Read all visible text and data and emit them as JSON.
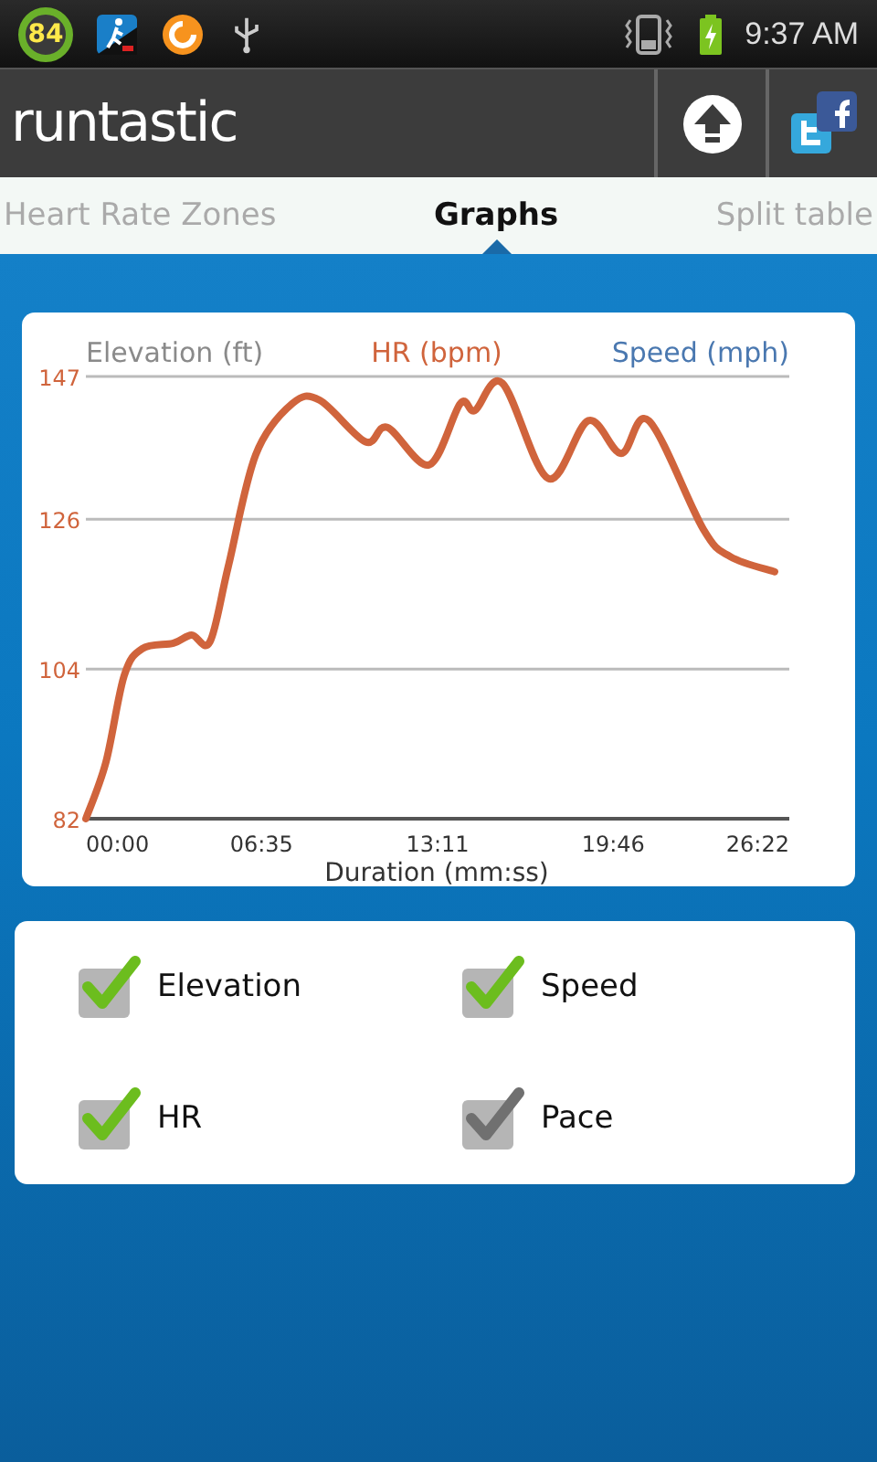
{
  "status_bar": {
    "battery_badge": "84",
    "time": "9:37 AM"
  },
  "header": {
    "logo": "runtastic"
  },
  "tabs": [
    {
      "label": "Heart Rate Zones",
      "selected": false
    },
    {
      "label": "Graphs",
      "selected": true
    },
    {
      "label": "Split table",
      "selected": false
    }
  ],
  "graph_card": {
    "legend": [
      {
        "label": "Elevation (ft)",
        "color": "#8a8a8a"
      },
      {
        "label": "Speed (mph)",
        "color": "#4a78b0"
      }
    ],
    "chart_data": {
      "type": "line",
      "xlabel": "Duration (mm:ss)",
      "xlim": [
        0,
        1582
      ],
      "ylim": [
        82,
        147
      ],
      "xticks": [
        {
          "value": 0,
          "label": "00:00"
        },
        {
          "value": 395,
          "label": "06:35"
        },
        {
          "value": 791,
          "label": "13:11"
        },
        {
          "value": 1186,
          "label": "19:46"
        },
        {
          "value": 1582,
          "label": "26:22"
        }
      ],
      "yticks": [
        82,
        104,
        126,
        147
      ],
      "x": [
        0,
        45,
        86,
        127,
        197,
        238,
        279,
        320,
        382,
        464,
        526,
        629,
        678,
        772,
        842,
        875,
        937,
        1040,
        1130,
        1204,
        1266,
        1389,
        1450,
        1549
      ],
      "series": [
        {
          "name": "HR (bpm)",
          "color": "#d0643c",
          "values": [
            82,
            90.3,
            103,
            107,
            107.8,
            109,
            108,
            119,
            135.5,
            143,
            143.5,
            137.4,
            139.5,
            134,
            143,
            142,
            146,
            132,
            140.5,
            135.7,
            140.5,
            124.5,
            120.5,
            118.3
          ]
        }
      ]
    }
  },
  "options": [
    {
      "label": "Elevation",
      "checked": true
    },
    {
      "label": "Speed",
      "checked": true
    },
    {
      "label": "HR",
      "checked": true
    },
    {
      "label": "Pace",
      "checked": false
    }
  ]
}
